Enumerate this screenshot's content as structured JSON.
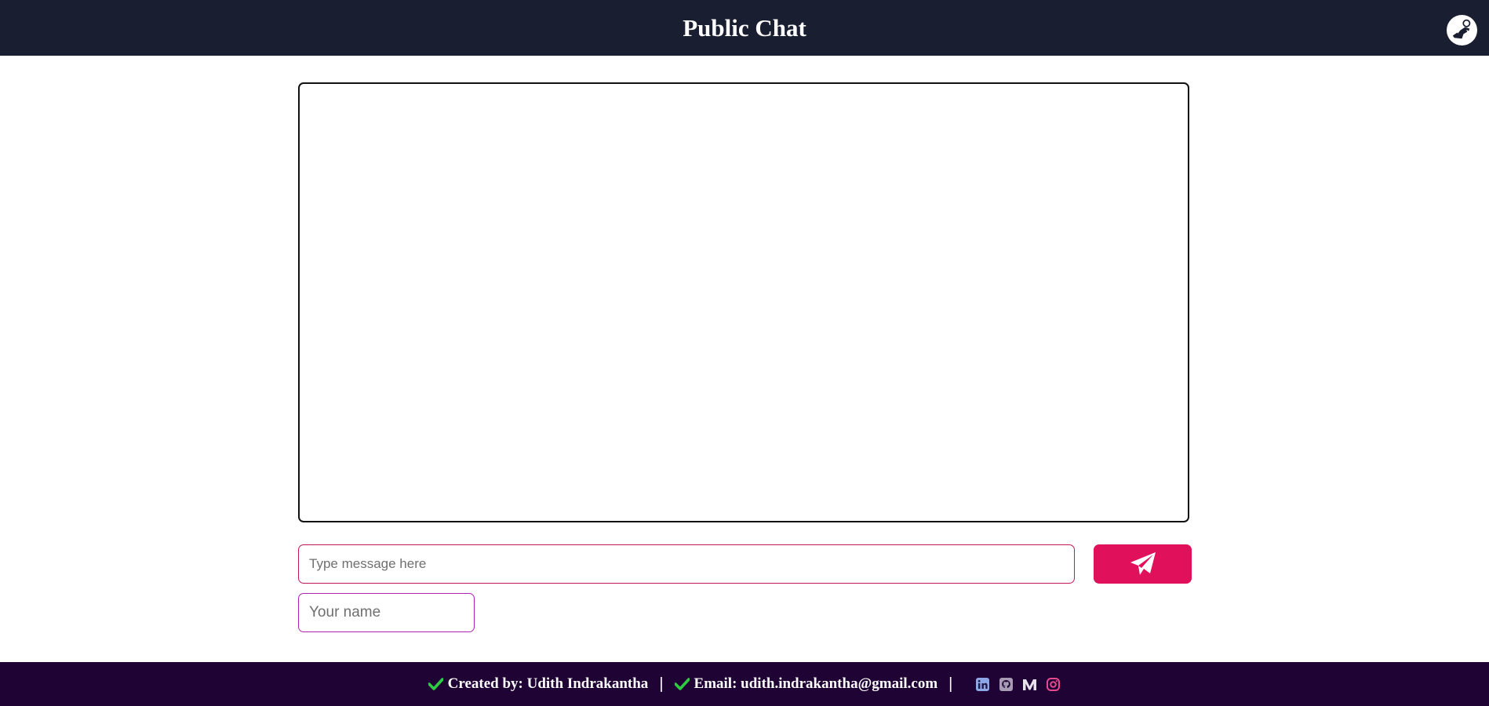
{
  "header": {
    "title": "Public Chat",
    "avatar_icon": "astronaut-avatar-icon"
  },
  "chat": {
    "messages": []
  },
  "composer": {
    "message_placeholder": "Type message here",
    "message_value": "",
    "name_placeholder": "Your name",
    "name_value": "",
    "send_icon": "paper-plane-icon"
  },
  "footer": {
    "created_by": "Created by: Udith Indrakantha",
    "email": "Email: udith.indrakantha@gmail.com",
    "separator": "|",
    "social_icons": [
      "linkedin-icon",
      "github-icon",
      "medium-icon",
      "instagram-icon"
    ]
  },
  "colors": {
    "header_bg": "#1a1e31",
    "footer_bg": "#200335",
    "accent": "#e0115a",
    "check": "#2ecc40"
  }
}
